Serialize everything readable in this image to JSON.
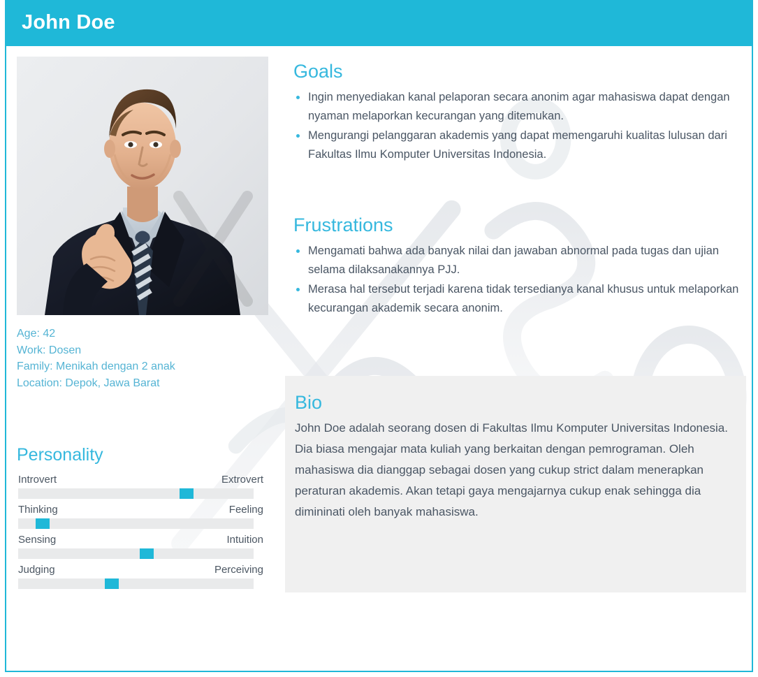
{
  "header": {
    "title": "John Doe",
    "accent_color": "#1fb8d8"
  },
  "profile": {
    "photo_alt": "portrait-of-man-in-dark-suit-with-striped-tie",
    "demographics": [
      "Age: 42",
      "Work: Dosen",
      "Family: Menikah dengan 2 anak",
      "Location: Depok, Jawa Barat"
    ]
  },
  "personality": {
    "title": "Personality",
    "traits": [
      {
        "left_label": "Introvert",
        "right_label": "Extrovert",
        "value": 73
      },
      {
        "left_label": "Thinking",
        "right_label": "Feeling",
        "value": 8
      },
      {
        "left_label": "Sensing",
        "right_label": "Intuition",
        "value": 55
      },
      {
        "left_label": "Judging",
        "right_label": "Perceiving",
        "value": 39
      }
    ]
  },
  "goals": {
    "title": "Goals",
    "items": [
      "Ingin menyediakan kanal pelaporan secara anonim agar mahasiswa dapat dengan nyaman melaporkan kecurangan yang ditemukan.",
      "Mengurangi pelanggaran akademis yang dapat memengaruhi kualitas lulusan dari Fakultas Ilmu Komputer Universitas Indonesia."
    ]
  },
  "frustrations": {
    "title": "Frustrations",
    "items": [
      "Mengamati bahwa ada banyak nilai dan jawaban abnormal pada tugas dan ujian selama dilaksanakannya PJJ.",
      "Merasa hal tersebut terjadi karena tidak tersedianya kanal khusus untuk melaporkan kecurangan akademik secara anonim."
    ]
  },
  "bio": {
    "title": "Bio",
    "text": "John Doe adalah seorang dosen di Fakultas Ilmu Komputer Universitas Indonesia. Dia biasa mengajar mata kuliah yang berkaitan dengan pemrograman. Oleh mahasiswa dia dianggap sebagai dosen yang cukup strict dalam menerapkan peraturan akademis. Akan tetapi gaya mengajarnya cukup enak sehingga dia dimininati oleh banyak mahasiswa."
  },
  "watermark": {
    "text": "Xtensio"
  }
}
